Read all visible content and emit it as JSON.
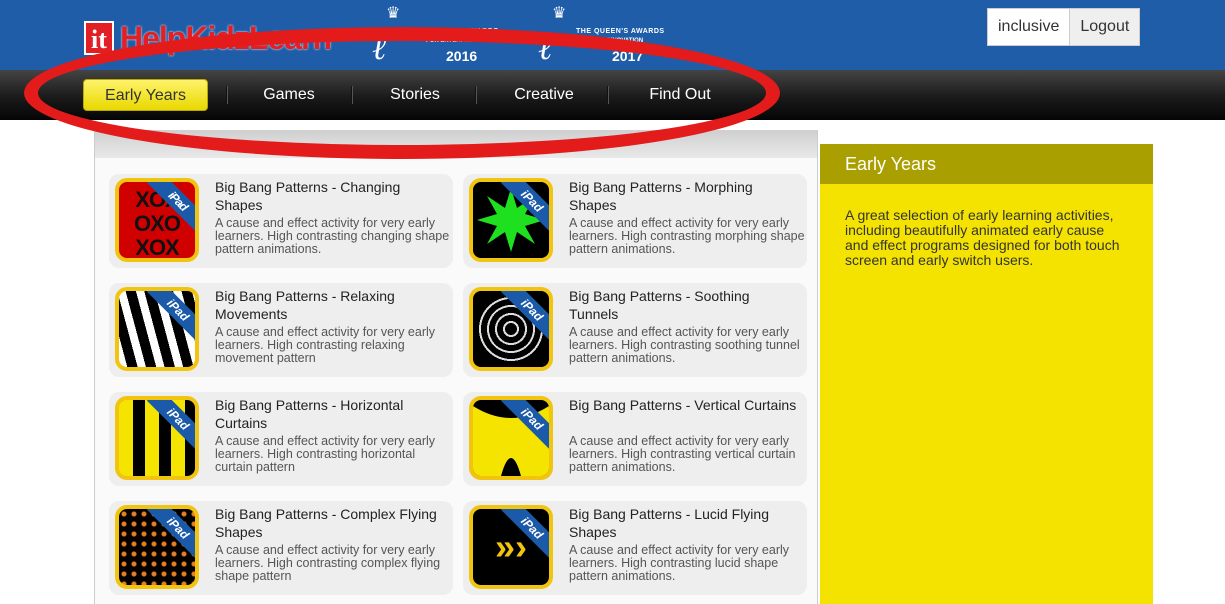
{
  "header": {
    "logo": {
      "prefix": "it",
      "brand": "HelpKidzLearn"
    },
    "awards": [
      {
        "line1": "THE QUEEN'S AWARDS",
        "line2": "FOR ENTERPRISE",
        "year": "2016"
      },
      {
        "line1": "THE QUEEN'S AWARDS",
        "line2": "FOR INNOVATION",
        "year": "2017"
      }
    ],
    "user": {
      "name": "inclusive",
      "logout": "Logout"
    }
  },
  "nav": {
    "items": [
      {
        "label": "Early Years",
        "active": true
      },
      {
        "label": "Games",
        "active": false
      },
      {
        "label": "Stories",
        "active": false
      },
      {
        "label": "Creative",
        "active": false
      },
      {
        "label": "Find Out",
        "active": false
      }
    ]
  },
  "badge": "iPad",
  "activities": [
    {
      "title": "Big Bang Patterns - Changing Shapes",
      "desc": "A cause and effect activity for very early learners. High contrasting changing shape pattern animations.",
      "icon": "xo-pattern-icon"
    },
    {
      "title": "Big Bang Patterns - Morphing Shapes",
      "desc": "A cause and effect activity for very early learners. High contrasting morphing shape pattern animations.",
      "icon": "green-star-icon"
    },
    {
      "title": "Big Bang Patterns - Relaxing Movements",
      "desc": "A cause and effect activity for very early learners. High contrasting relaxing movement pattern",
      "icon": "zebra-stripes-icon"
    },
    {
      "title": "Big Bang Patterns - Soothing Tunnels",
      "desc": "A cause and effect activity for very early learners. High contrasting soothing tunnel pattern animations.",
      "icon": "tunnel-rings-icon"
    },
    {
      "title": "Big Bang Patterns - Horizontal Curtains",
      "desc": "A cause and effect activity for very early learners. High contrasting horizontal curtain pattern",
      "icon": "yellow-stripes-icon"
    },
    {
      "title": "Big Bang Patterns - Vertical Curtains",
      "desc": "A cause and effect activity for very early learners. High contrasting vertical curtain pattern animations.",
      "icon": "yellow-curtain-icon"
    },
    {
      "title": "Big Bang Patterns - Complex Flying Shapes",
      "desc": "A cause and effect activity for very early learners. High contrasting complex flying shape pattern",
      "icon": "orange-dots-icon"
    },
    {
      "title": "Big Bang Patterns - Lucid Flying Shapes",
      "desc": "A cause and effect activity for very early learners. High contrasting lucid shape pattern animations.",
      "icon": "yellow-chevrons-icon"
    }
  ],
  "sidebar": {
    "title": "Early Years",
    "text": "A great selection of early learning activities, including beautifully animated early cause and effect programs designed for both touch screen and early switch users."
  },
  "colors": {
    "header_blue": "#1f5da8",
    "nav_active": "#f0e000",
    "annotation_red": "#e31b1b",
    "info_yellow": "#f4e300",
    "info_header": "#aa9f00"
  }
}
